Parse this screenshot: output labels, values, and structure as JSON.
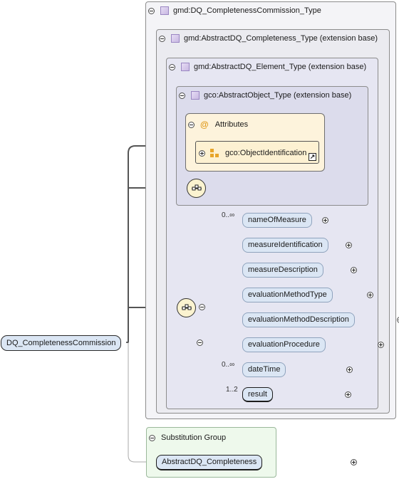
{
  "root_element": {
    "label": "DQ_CompletenessCommission"
  },
  "type_boxes": [
    {
      "label": "gmd:DQ_CompletenessCommission_Type"
    },
    {
      "label": "gmd:AbstractDQ_Completeness_Type (extension base)"
    },
    {
      "label": "gmd:AbstractDQ_Element_Type (extension base)"
    },
    {
      "label": "gco:AbstractObject_Type (extension base)"
    }
  ],
  "attributes": {
    "title": "Attributes",
    "at_symbol": "@",
    "group": "gco:ObjectIdentification",
    "shortcut_icon": "↗"
  },
  "sequence": {
    "elements": [
      {
        "label": "nameOfMeasure",
        "occurrence": "0..∞"
      },
      {
        "label": "measureIdentification",
        "occurrence": ""
      },
      {
        "label": "measureDescription",
        "occurrence": ""
      },
      {
        "label": "evaluationMethodType",
        "occurrence": ""
      },
      {
        "label": "evaluationMethodDescription",
        "occurrence": ""
      },
      {
        "label": "evaluationProcedure",
        "occurrence": ""
      },
      {
        "label": "dateTime",
        "occurrence": "0..∞"
      },
      {
        "label": "result",
        "occurrence": "1..2"
      }
    ]
  },
  "substitution_group": {
    "title": "Substitution Group",
    "element": "AbstractDQ_Completeness"
  },
  "colors": {
    "element_fill": "#dbe6f4",
    "attributes_fill": "#fdf3dc",
    "substitution_fill": "#eef9ec",
    "type_icon": "#c8b8e2"
  }
}
